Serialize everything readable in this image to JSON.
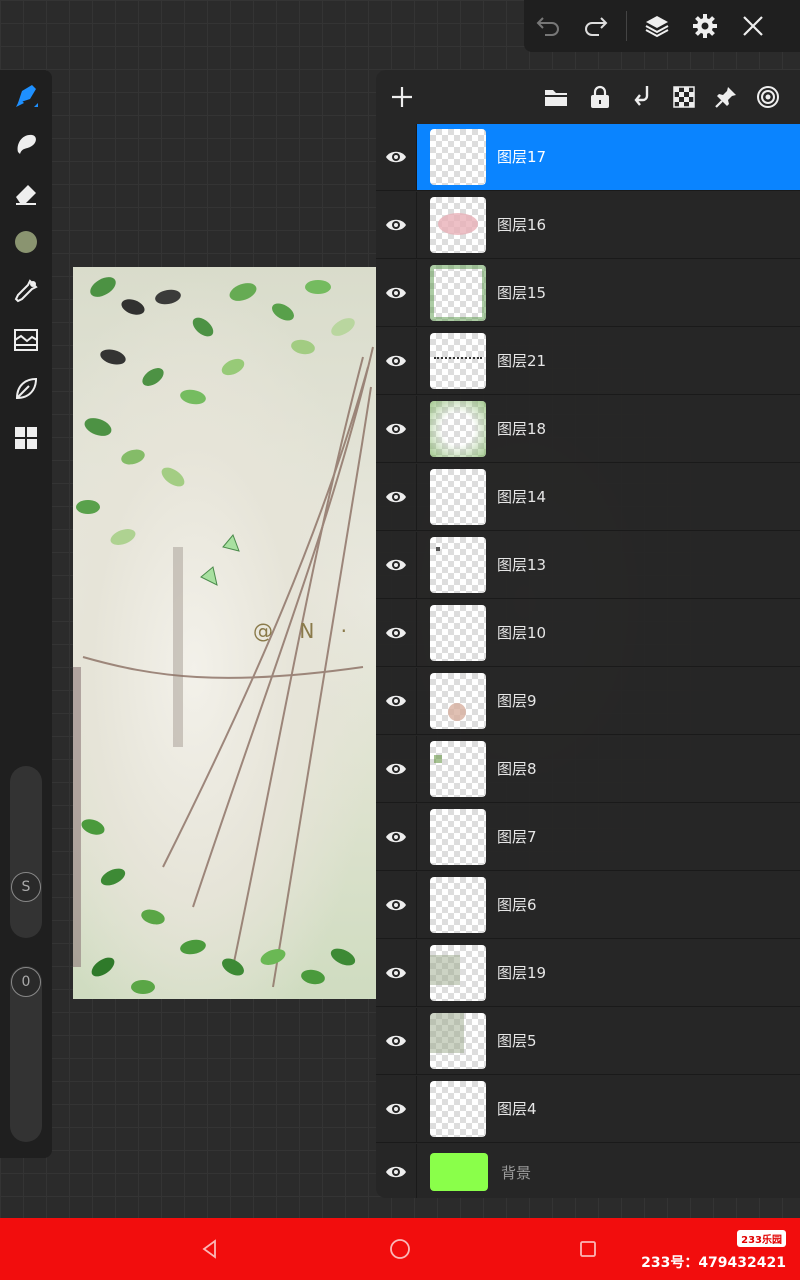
{
  "top_toolbar": {
    "icons": [
      "undo-icon",
      "redo-icon",
      "layers-icon",
      "gear-icon",
      "close-icon"
    ]
  },
  "left_toolbar": {
    "tools": [
      "brush-icon",
      "smudge-icon",
      "eraser-icon",
      "color-swatch",
      "eyedropper-icon",
      "adjust-icon",
      "leaf-icon",
      "grid-icon"
    ],
    "active_color": "#8a9470",
    "size_label": "S",
    "opacity_label": "0"
  },
  "canvas": {
    "watermark_text": "@ N ·"
  },
  "layers_panel": {
    "header_icons": [
      "add-icon",
      "folder-icon",
      "lock-icon",
      "merge-down-icon",
      "checker-icon",
      "pin-icon",
      "target-icon"
    ],
    "selected_index": 0,
    "accent_color": "#0a84ff",
    "layers": [
      {
        "name": "图层17"
      },
      {
        "name": "图层16"
      },
      {
        "name": "图层15"
      },
      {
        "name": "图层21"
      },
      {
        "name": "图层18"
      },
      {
        "name": "图层14"
      },
      {
        "name": "图层13"
      },
      {
        "name": "图层10"
      },
      {
        "name": "图层9"
      },
      {
        "name": "图层8"
      },
      {
        "name": "图层7"
      },
      {
        "name": "图层6"
      },
      {
        "name": "图层19"
      },
      {
        "name": "图层5"
      },
      {
        "name": "图层4"
      }
    ],
    "background_layer": {
      "name": "背景",
      "color": "#8aff4a"
    }
  },
  "nav_bar": {
    "color": "#f20d0d",
    "badge": "233乐园",
    "id_text": "233号：479432421"
  }
}
